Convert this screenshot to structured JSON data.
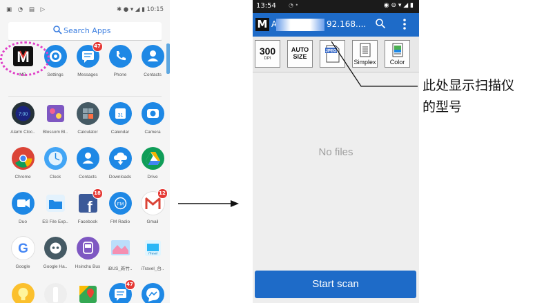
{
  "left_phone": {
    "status_time": "10:15",
    "search_placeholder": "Search Apps",
    "apps": [
      {
        "label": "MB",
        "icon": "mb-logo-icon",
        "color": "#111111",
        "badge": ""
      },
      {
        "label": "Settings",
        "icon": "gear-icon",
        "color": "#1e88e5",
        "badge": ""
      },
      {
        "label": "Messages",
        "icon": "message-icon",
        "color": "#1e88e5",
        "badge": "47"
      },
      {
        "label": "Phone",
        "icon": "phone-icon",
        "color": "#1e88e5",
        "badge": ""
      },
      {
        "label": "Contacts",
        "icon": "contacts-icon",
        "color": "#1e88e5",
        "badge": ""
      },
      {
        "label": "Alarm Cloc..",
        "icon": "clock-face-icon",
        "color": "#263238",
        "badge": ""
      },
      {
        "label": "Blossom Bl..",
        "icon": "game-icon",
        "color": "#7e57c2",
        "badge": ""
      },
      {
        "label": "Calculator",
        "icon": "calculator-icon",
        "color": "#455a64",
        "badge": ""
      },
      {
        "label": "Calendar",
        "icon": "calendar-icon",
        "color": "#1e88e5",
        "badge": ""
      },
      {
        "label": "Camera",
        "icon": "camera-icon",
        "color": "#1e88e5",
        "badge": ""
      },
      {
        "label": "Chrome",
        "icon": "chrome-icon",
        "color": "#db4437",
        "badge": ""
      },
      {
        "label": "Clock",
        "icon": "clock-icon",
        "color": "#42a5f5",
        "badge": ""
      },
      {
        "label": "Contacts",
        "icon": "contacts-icon",
        "color": "#1e88e5",
        "badge": ""
      },
      {
        "label": "Downloads",
        "icon": "download-icon",
        "color": "#1e88e5",
        "badge": ""
      },
      {
        "label": "Drive",
        "icon": "drive-icon",
        "color": "#0f9d58",
        "badge": ""
      },
      {
        "label": "Duo",
        "icon": "video-icon",
        "color": "#1e88e5",
        "badge": ""
      },
      {
        "label": "ES File Exp..",
        "icon": "folder-icon",
        "color": "#1976d2",
        "badge": ""
      },
      {
        "label": "Facebook",
        "icon": "facebook-icon",
        "color": "#3b5998",
        "badge": "18"
      },
      {
        "label": "FM Radio",
        "icon": "radio-icon",
        "color": "#1e88e5",
        "badge": ""
      },
      {
        "label": "Gmail",
        "icon": "gmail-icon",
        "color": "#ffffff",
        "badge": "12"
      },
      {
        "label": "Google",
        "icon": "google-icon",
        "color": "#ffffff",
        "badge": ""
      },
      {
        "label": "Google Ha..",
        "icon": "hangouts-icon",
        "color": "#455a64",
        "badge": ""
      },
      {
        "label": "Hsinchu Bus",
        "icon": "bus-icon",
        "color": "#7e57c2",
        "badge": ""
      },
      {
        "label": "iBUS_新竹..",
        "icon": "map-thumbnail-icon",
        "color": "#64b5f6",
        "badge": ""
      },
      {
        "label": "iTravel_台..",
        "icon": "itravel-icon",
        "color": "#29b6f6",
        "badge": ""
      },
      {
        "label": "",
        "icon": "bulb-icon",
        "color": "#fbc02d",
        "badge": ""
      },
      {
        "label": "",
        "icon": "flashlight-icon",
        "color": "#eeeeee",
        "badge": ""
      },
      {
        "label": "",
        "icon": "maps-icon",
        "color": "#34a853",
        "badge": ""
      },
      {
        "label": "",
        "icon": "message-icon",
        "color": "#1e88e5",
        "badge": "47"
      },
      {
        "label": "",
        "icon": "messenger-icon",
        "color": "#1e88e5",
        "badge": ""
      }
    ]
  },
  "right_phone": {
    "status_time": "13:54",
    "app_title_start": "A",
    "app_title_ip": "92.168....",
    "toolbar": {
      "dpi_value": "300",
      "dpi_unit": "DPI",
      "size_line1": "AUTO",
      "size_line2": "SIZE",
      "format_label": "JPEG",
      "simplex_label": "Simplex",
      "color_label": "Color"
    },
    "empty_message": "No files",
    "scan_button": "Start scan"
  },
  "callout": {
    "line1": "此处显示扫描仪",
    "line2": "的型号"
  },
  "colors": {
    "accent_blue": "#1e6bc8",
    "highlight_magenta": "#e040c8",
    "badge_red": "#e53935"
  }
}
